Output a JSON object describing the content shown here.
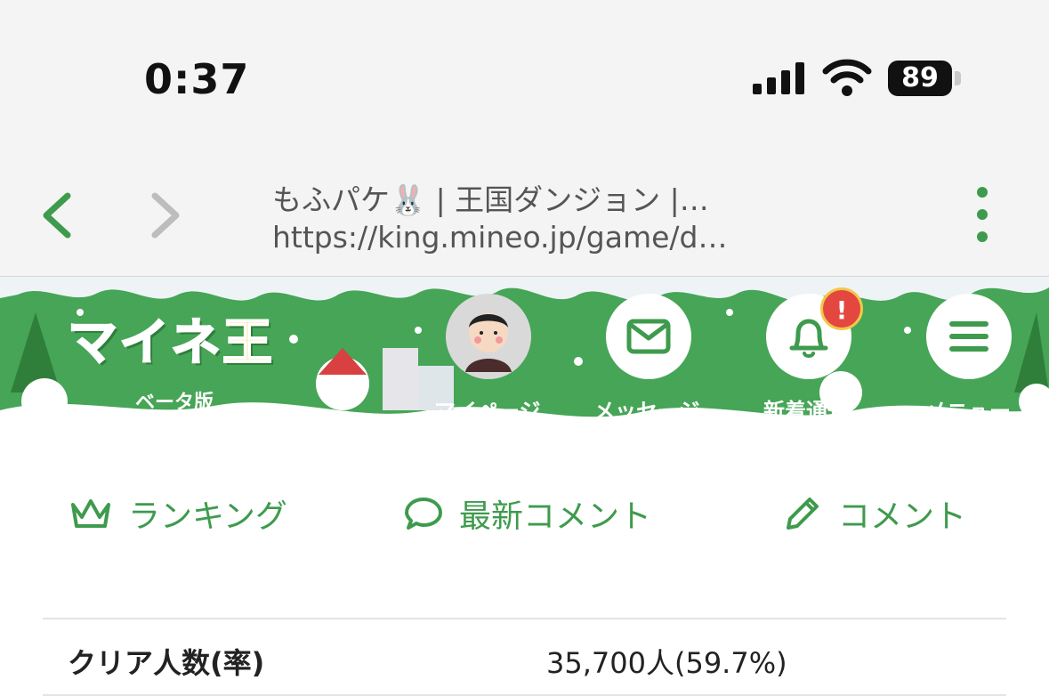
{
  "status_bar": {
    "time": "0:37",
    "battery": "89"
  },
  "browser": {
    "page_title": "もふパケ🐰 | 王国ダンジョン |…",
    "url": "https://king.mineo.jp/game/d…",
    "accent_color": "#3e9b4d"
  },
  "header": {
    "logo_text": "マイネ",
    "logo_text_2": "王",
    "beta_label": "ベータ版",
    "buttons": [
      {
        "label": "マイページ",
        "icon": "avatar"
      },
      {
        "label": "メッセージ",
        "icon": "mail-icon"
      },
      {
        "label": "新着通知",
        "icon": "bell-icon",
        "badge": "!"
      },
      {
        "label": "メニュー",
        "icon": "menu-icon"
      }
    ]
  },
  "tabs": [
    {
      "label": "ランキング",
      "icon": "crown-icon"
    },
    {
      "label": "最新コメント",
      "icon": "speech-bubble-icon"
    },
    {
      "label": "コメント",
      "icon": "pencil-icon"
    }
  ],
  "stats": {
    "clear_label": "クリア人数(率)",
    "clear_value": "35,700人(59.7%)"
  }
}
